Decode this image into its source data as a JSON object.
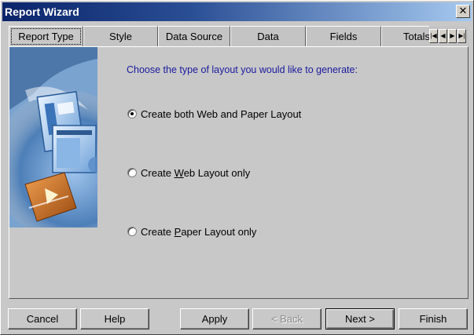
{
  "window": {
    "title": "Report Wizard",
    "close_glyph": "✕"
  },
  "tabs": [
    {
      "label": "Report Type",
      "active": true
    },
    {
      "label": "Style"
    },
    {
      "label": "Data Source"
    },
    {
      "label": "Data"
    },
    {
      "label": "Fields"
    },
    {
      "label": "Totals"
    }
  ],
  "tab_scroll": {
    "first": "|◀",
    "prev": "◀",
    "next": "▶",
    "last": "▶|"
  },
  "content": {
    "prompt": "Choose the type of layout you would like to generate:",
    "options": [
      {
        "pre": "Create both Web and Paper Layout",
        "u": "",
        "post": "",
        "checked": true
      },
      {
        "pre": "Create ",
        "u": "W",
        "post": "eb Layout only",
        "checked": false
      },
      {
        "pre": "Create ",
        "u": "P",
        "post": "aper Layout only",
        "checked": false
      }
    ]
  },
  "buttons": {
    "cancel": "Cancel",
    "help": "Help",
    "apply": "Apply",
    "back": "< Back",
    "next": "Next >",
    "finish": "Finish"
  },
  "colors": {
    "title_gradient_start": "#0a246a",
    "prompt_text": "#1a1a9e",
    "panel_bg": "#c8c8c8"
  }
}
